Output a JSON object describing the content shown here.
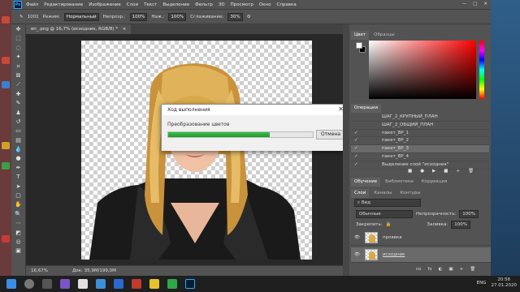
{
  "menubar": {
    "logo": "Ps",
    "items": [
      "Файл",
      "Редактирование",
      "Изображение",
      "Слои",
      "Текст",
      "Выделение",
      "Фильтр",
      "3D",
      "Просмотр",
      "Окно",
      "Справка"
    ],
    "controls": [
      "—",
      "□",
      "✕"
    ]
  },
  "options": {
    "brush_size": "1001",
    "mode_label": "Режим:",
    "mode_value": "Нормальный",
    "opacity_label": "Непрозр.:",
    "opacity_value": "100%",
    "pressure_label": "Наж.:",
    "pressure_value": "100%",
    "smoothing_label": "Сглаживание:",
    "smoothing_value": "30%"
  },
  "document": {
    "tab_title": "вп_.png @ 16,7% (исходник, RGB/8) *",
    "tab_close": "×",
    "zoom": "16,67%",
    "doc_size": "Док: 35,9M/199,0M"
  },
  "dialog": {
    "title": "Ход выполнения",
    "close": "✕",
    "message": "Преобразование цветов",
    "progress": 0.7,
    "cancel_label": "Отмена"
  },
  "color_panel": {
    "tabs": [
      "Цвет",
      "Образцы"
    ],
    "foreground": "#ffffff",
    "background": "#000000",
    "hue_color": "#ff0000"
  },
  "actions_panel": {
    "tabs": [
      "Операции"
    ],
    "items": [
      {
        "check": "",
        "label": "ШАГ_2_КРУПНЫЙ_ПЛАН",
        "highlighted": false
      },
      {
        "check": "",
        "label": "ШАГ_2_ОБЩИЙ_ПЛАН",
        "highlighted": false
      },
      {
        "check": "✓",
        "label": "пакет_ВР_1",
        "highlighted": false
      },
      {
        "check": "✓",
        "label": "пакет_ВР_2",
        "highlighted": false
      },
      {
        "check": "✓",
        "label": "пакет_ВР_3",
        "highlighted": true
      },
      {
        "check": "✓",
        "label": "пакет_ВР_4",
        "highlighted": false
      },
      {
        "check": "✓",
        "label": "Выделение слой \"исходник\"",
        "highlighted": false
      }
    ],
    "toolbar_icons": [
      "■",
      "●",
      "▶",
      "■",
      "+",
      "🗑"
    ]
  },
  "learn_tabs": [
    "Обучение",
    "Библиотеки",
    "Коррекция"
  ],
  "layers_panel": {
    "tabs": [
      "Слои",
      "Каналы",
      "Контуры"
    ],
    "search_placeholder": "Вид",
    "blend_mode": "Обычные",
    "opacity_label": "Непрозрачность:",
    "opacity_value": "100%",
    "lock_label": "Закрепить:",
    "fill_label": "Заливка:",
    "fill_value": "100%",
    "layers": [
      {
        "name": "проявка",
        "selected": false
      },
      {
        "name": "исходник",
        "selected": true
      }
    ],
    "bottom_icons": [
      "co",
      "fx",
      "◐",
      "▣",
      "+",
      "🗑"
    ]
  },
  "taskbar": {
    "icons": [
      "start",
      "search",
      "task-view",
      "ps",
      "browser",
      "files",
      "mail"
    ],
    "tray_lang": "ENG",
    "time": "20:56",
    "date": "27.01.2020"
  }
}
